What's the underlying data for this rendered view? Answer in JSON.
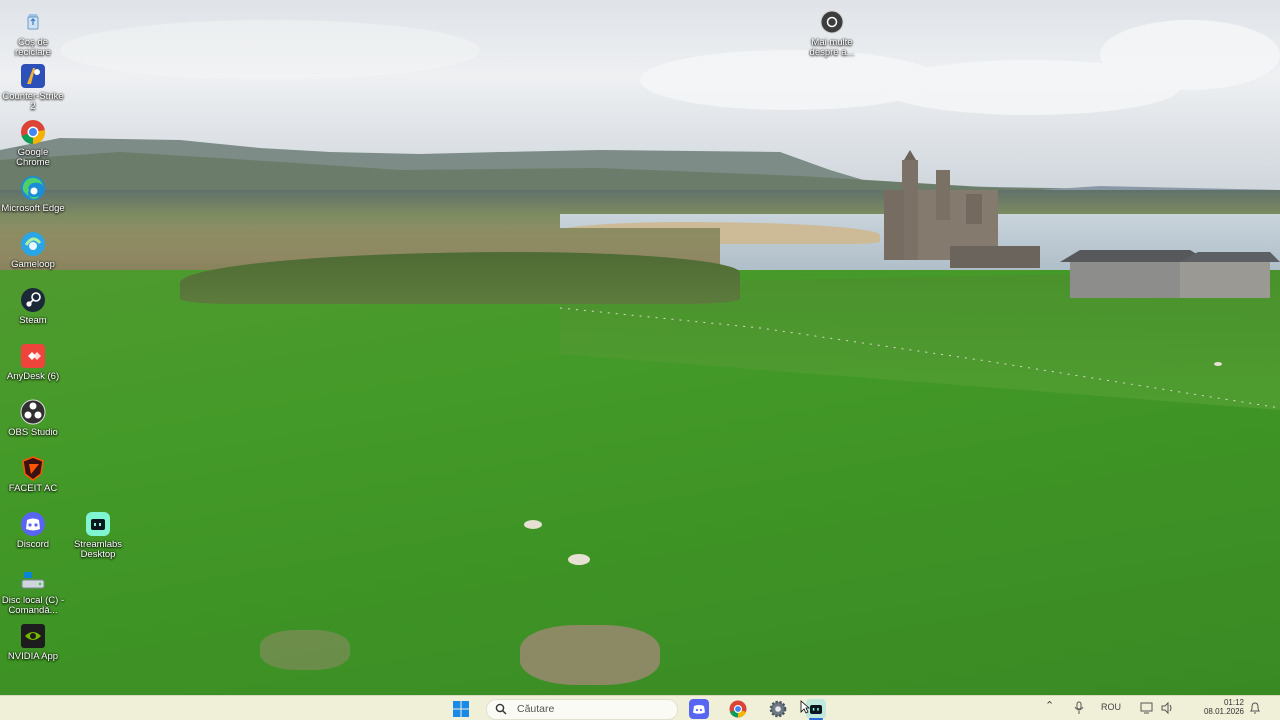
{
  "desktop_icons": [
    {
      "id": "recycle",
      "label": "Coș de reciclare",
      "icon": "recycle-bin-icon"
    },
    {
      "id": "cs2",
      "label": "Counter-Strike 2",
      "icon": "counter-strike-icon"
    },
    {
      "id": "chrome",
      "label": "Google Chrome",
      "icon": "chrome-icon"
    },
    {
      "id": "edge",
      "label": "Microsoft Edge",
      "icon": "edge-icon"
    },
    {
      "id": "gameloop",
      "label": "Gameloop",
      "icon": "gameloop-icon"
    },
    {
      "id": "steam",
      "label": "Steam",
      "icon": "steam-icon"
    },
    {
      "id": "anydesk",
      "label": "AnyDesk (6)",
      "icon": "anydesk-icon"
    },
    {
      "id": "obs",
      "label": "OBS Studio",
      "icon": "obs-icon"
    },
    {
      "id": "faceit",
      "label": "FACEIT AC",
      "icon": "faceit-icon"
    },
    {
      "id": "discord",
      "label": "Discord",
      "icon": "discord-icon"
    },
    {
      "id": "streamlabs",
      "label": "Streamlabs Desktop",
      "icon": "streamlabs-icon"
    },
    {
      "id": "disk",
      "label": "Disc local (C) - Comandă...",
      "icon": "drive-icon"
    },
    {
      "id": "nvidia",
      "label": "NVIDIA App",
      "icon": "nvidia-icon"
    },
    {
      "id": "more",
      "label": "Mai multe despre a...",
      "icon": "camera-info-icon"
    }
  ],
  "taskbar": {
    "search_placeholder": "Căutare",
    "apps": [
      "discord-icon",
      "chrome-icon",
      "settings-icon",
      "streamlabs-icon"
    ],
    "tray": {
      "language": "ROU",
      "time": "01:12",
      "date": "08.01.2026"
    }
  },
  "colors": {
    "taskbar_bg": "#f0efd8",
    "field_green": "#3f9427"
  }
}
